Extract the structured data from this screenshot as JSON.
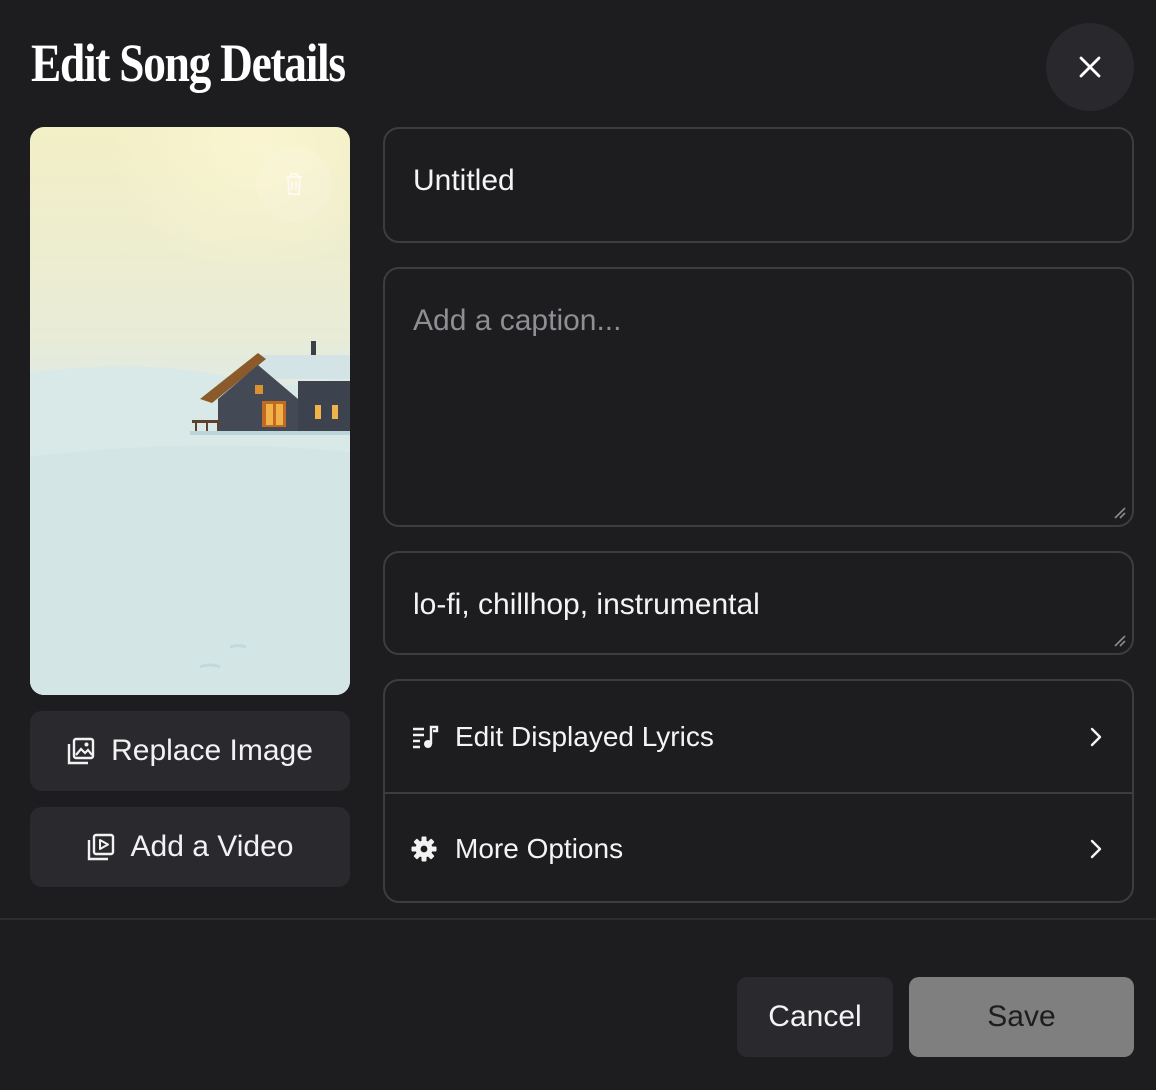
{
  "dialog": {
    "title": "Edit Song Details",
    "close_icon": "close-icon"
  },
  "cover": {
    "image": "snowy-cabin-artwork",
    "delete_icon": "trash-icon",
    "replace_label": "Replace Image",
    "replace_icon": "image-icon",
    "video_label": "Add a Video",
    "video_icon": "video-icon"
  },
  "form": {
    "title_value": "Untitled",
    "caption_value": "",
    "caption_placeholder": "Add a caption...",
    "tags_value": "lo-fi, chillhop, instrumental"
  },
  "menu": {
    "items": [
      {
        "label": "Edit Displayed Lyrics",
        "icon": "lyrics-icon"
      },
      {
        "label": "More Options",
        "icon": "gear-icon"
      }
    ]
  },
  "footer": {
    "cancel_label": "Cancel",
    "save_label": "Save"
  },
  "colors": {
    "background": "#1d1d20",
    "surface": "#2a2a2e",
    "border": "#3c3c41",
    "save_disabled": "#7f7f7f"
  }
}
